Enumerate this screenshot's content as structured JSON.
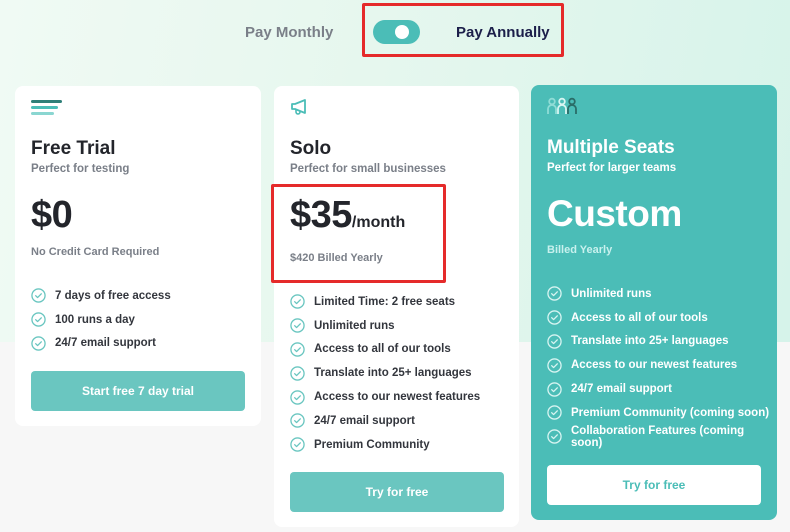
{
  "billing": {
    "monthly_label": "Pay Monthly",
    "annually_label": "Pay Annually",
    "selected": "annually"
  },
  "colors": {
    "accent": "#4bbdb7",
    "button": "#6ac6c0",
    "heading": "#23252b",
    "muted": "#7a7f88",
    "annotation": "#e52a2a"
  },
  "plans": [
    {
      "icon": "lines-icon",
      "name": "Free Trial",
      "subtitle": "Perfect for testing",
      "price": "$0",
      "price_suffix": "",
      "price_note": "No Credit Card Required",
      "features": [
        "7 days of free access",
        "100 runs a day",
        "24/7 email support"
      ],
      "cta": "Start free 7 day trial"
    },
    {
      "icon": "megaphone-icon",
      "name": "Solo",
      "subtitle": "Perfect for small businesses",
      "price": "$35",
      "price_suffix": "/month",
      "price_note": "$420 Billed Yearly",
      "features": [
        "Limited Time: 2 free seats",
        "Unlimited runs",
        "Access to all of our tools",
        "Translate into 25+ languages",
        "Access to our newest features",
        "24/7 email support",
        "Premium Community"
      ],
      "cta": "Try for free"
    },
    {
      "icon": "users-icon",
      "name": "Multiple Seats",
      "subtitle": "Perfect for larger teams",
      "price": "Custom",
      "price_suffix": "",
      "price_note": "Billed Yearly",
      "features": [
        "Unlimited runs",
        "Access to all of our tools",
        "Translate into 25+ languages",
        "Access to our newest features",
        "24/7 email support",
        "Premium Community (coming soon)",
        "Collaboration Features (coming soon)"
      ],
      "cta": "Try for free"
    }
  ]
}
